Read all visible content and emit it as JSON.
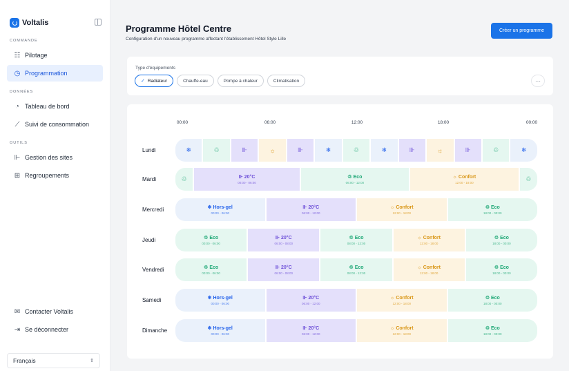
{
  "app": {
    "brand": "Voltalis"
  },
  "sidebar": {
    "sections": [
      {
        "title": "COMMANDE",
        "items": [
          {
            "label": "Pilotage",
            "icon": "sliders-icon"
          },
          {
            "label": "Programmation",
            "icon": "clock-icon",
            "active": true
          }
        ]
      },
      {
        "title": "DONNÉES",
        "items": [
          {
            "label": "Tableau de bord",
            "icon": "dashboard-icon"
          },
          {
            "label": "Suivi de consommation",
            "icon": "trend-icon"
          }
        ]
      },
      {
        "title": "OUTILS",
        "items": [
          {
            "label": "Gestion des sites",
            "icon": "sites-icon"
          },
          {
            "label": "Regroupements",
            "icon": "grid-icon"
          }
        ]
      }
    ],
    "bottom": [
      {
        "label": "Contacter Voltalis",
        "icon": "mail-icon"
      },
      {
        "label": "Se déconnecter",
        "icon": "logout-icon"
      }
    ],
    "language": "Français"
  },
  "header": {
    "title": "Programme Hôtel Centre",
    "subtitle": "Configuration d'un nouveau programme affectant l'établissement Hôtel Style Lille",
    "create_button": "Créer un programme"
  },
  "equipment": {
    "label": "Type d'équipements",
    "options": [
      {
        "label": "Radiateur",
        "selected": true
      },
      {
        "label": "Chauffe-eau",
        "selected": false
      },
      {
        "label": "Pompe à chaleur",
        "selected": false
      },
      {
        "label": "Climatisation",
        "selected": false
      }
    ],
    "more": "···"
  },
  "schedule": {
    "ticks": [
      "00:00",
      "06:00",
      "12:00",
      "18:00",
      "00:00"
    ],
    "modes": {
      "hg": {
        "label": "Hors-gel",
        "color": "#2563eb"
      },
      "20": {
        "label": "20°C",
        "color": "#6d4fd8"
      },
      "cf": {
        "label": "Confort",
        "color": "#d99616"
      },
      "eco": {
        "label": "Eco",
        "color": "#1fa876"
      }
    },
    "days": [
      {
        "name": "Lundi",
        "segments": [
          {
            "mode": "hg",
            "span": 1
          },
          {
            "mode": "eco",
            "span": 1
          },
          {
            "mode": "20",
            "span": 1
          },
          {
            "mode": "cf",
            "span": 1
          },
          {
            "mode": "20",
            "span": 1
          },
          {
            "mode": "hg",
            "span": 1
          },
          {
            "mode": "eco",
            "span": 1
          },
          {
            "mode": "hg",
            "span": 1
          },
          {
            "mode": "20",
            "span": 1
          },
          {
            "mode": "cf",
            "span": 1
          },
          {
            "mode": "20",
            "span": 1
          },
          {
            "mode": "eco",
            "span": 1
          },
          {
            "mode": "hg",
            "span": 1
          }
        ]
      },
      {
        "name": "Mardi",
        "segments": [
          {
            "mode": "eco",
            "span": 0.6
          },
          {
            "mode": "20",
            "span": 3.6,
            "label": "20°C",
            "time": "00:00 - 06:00"
          },
          {
            "mode": "eco",
            "span": 3.7,
            "label": "Eco",
            "time": "06:00 - 12:00"
          },
          {
            "mode": "cf",
            "span": 3.7,
            "label": "Confort",
            "time": "12:00 - 18:00"
          },
          {
            "mode": "eco",
            "span": 0.6
          }
        ]
      },
      {
        "name": "Mercredi",
        "segments": [
          {
            "mode": "hg",
            "span": 1,
            "label": "Hors-gel",
            "time": "00:00 - 06:00"
          },
          {
            "mode": "20",
            "span": 1,
            "label": "20°C",
            "time": "06:00 - 12:00"
          },
          {
            "mode": "cf",
            "span": 1,
            "label": "Confort",
            "time": "12:00 - 18:00"
          },
          {
            "mode": "eco",
            "span": 1,
            "label": "Eco",
            "time": "18:00 - 00:00"
          }
        ]
      },
      {
        "name": "Jeudi",
        "segments": [
          {
            "mode": "eco",
            "span": 1,
            "label": "Eco",
            "time": "00:00 - 06:00"
          },
          {
            "mode": "20",
            "span": 1,
            "label": "20°C",
            "time": "06:00 - 08:00"
          },
          {
            "mode": "eco",
            "span": 1,
            "label": "Eco",
            "time": "08:00 - 12:00"
          },
          {
            "mode": "cf",
            "span": 1,
            "label": "Confort",
            "time": "12:00 - 18:00"
          },
          {
            "mode": "eco",
            "span": 1,
            "label": "Eco",
            "time": "18:00 - 00:00"
          }
        ]
      },
      {
        "name": "Vendredi",
        "segments": [
          {
            "mode": "eco",
            "span": 1,
            "label": "Eco",
            "time": "00:00 - 06:00"
          },
          {
            "mode": "20",
            "span": 1,
            "label": "20°C",
            "time": "06:00 - 08:00"
          },
          {
            "mode": "eco",
            "span": 1,
            "label": "Eco",
            "time": "08:00 - 12:00"
          },
          {
            "mode": "cf",
            "span": 1,
            "label": "Confort",
            "time": "12:00 - 18:00"
          },
          {
            "mode": "eco",
            "span": 1,
            "label": "Eco",
            "time": "18:00 - 00:00"
          }
        ]
      },
      {
        "name": "Samedi",
        "segments": [
          {
            "mode": "hg",
            "span": 1,
            "label": "Hors-gel",
            "time": "00:00 - 06:00"
          },
          {
            "mode": "20",
            "span": 1,
            "label": "20°C",
            "time": "06:00 - 12:00"
          },
          {
            "mode": "cf",
            "span": 1,
            "label": "Confort",
            "time": "12:00 - 18:00"
          },
          {
            "mode": "eco",
            "span": 1,
            "label": "Eco",
            "time": "18:00 - 00:00"
          }
        ]
      },
      {
        "name": "Dimanche",
        "segments": [
          {
            "mode": "hg",
            "span": 1,
            "label": "Hors-gel",
            "time": "00:00 - 06:00"
          },
          {
            "mode": "20",
            "span": 1,
            "label": "20°C",
            "time": "06:00 - 12:00"
          },
          {
            "mode": "cf",
            "span": 1,
            "label": "Confort",
            "time": "12:00 - 18:00"
          },
          {
            "mode": "eco",
            "span": 1,
            "label": "Eco",
            "time": "18:00 - 00:00"
          }
        ]
      }
    ]
  }
}
